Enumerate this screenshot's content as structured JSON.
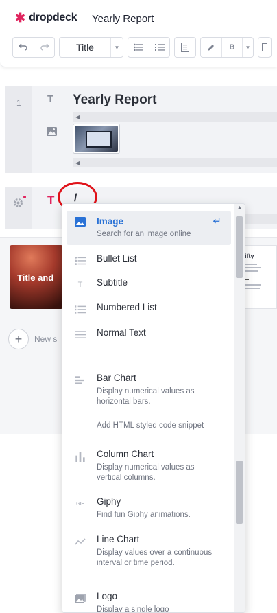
{
  "brand": {
    "mark": "✱",
    "name": "dropdeck"
  },
  "document": {
    "title": "Yearly Report"
  },
  "toolbar": {
    "style_value": "Title",
    "bold_label": "B"
  },
  "editor": {
    "slide_number": "1",
    "heading": "Yearly Report",
    "slash_input": "/"
  },
  "slides": {
    "slide1_title": "Title and",
    "slide2_title": "ty Fifty",
    "new_slide_label": "New s"
  },
  "menu": {
    "items": [
      {
        "title": "Image",
        "desc": "Search for an image online",
        "icon": "image-icon"
      },
      {
        "title": "Bullet List",
        "desc": "",
        "icon": "bullet-list-icon"
      },
      {
        "title": "Subtitle",
        "desc": "",
        "icon": "text-icon"
      },
      {
        "title": "Numbered List",
        "desc": "",
        "icon": "numbered-list-icon"
      },
      {
        "title": "Normal Text",
        "desc": "",
        "icon": "paragraph-icon"
      },
      {
        "title": "Bar Chart",
        "desc": "Display numerical values as horizontal bars.",
        "icon": "bar-chart-icon"
      },
      {
        "title": "",
        "desc": "Add HTML styled code snippet",
        "icon": ""
      },
      {
        "title": "Column Chart",
        "desc": "Display numerical values as vertical columns.",
        "icon": "column-chart-icon"
      },
      {
        "title": "Giphy",
        "desc": "Find fun Giphy animations.",
        "icon": "gif-icon"
      },
      {
        "title": "Line Chart",
        "desc": "Display values over a continuous interval or time period.",
        "icon": "line-chart-icon"
      },
      {
        "title": "Logo",
        "desc": "Display a single logo",
        "icon": "logo-icon"
      }
    ],
    "enter_hint": "↵",
    "gif_label": "GIF"
  }
}
